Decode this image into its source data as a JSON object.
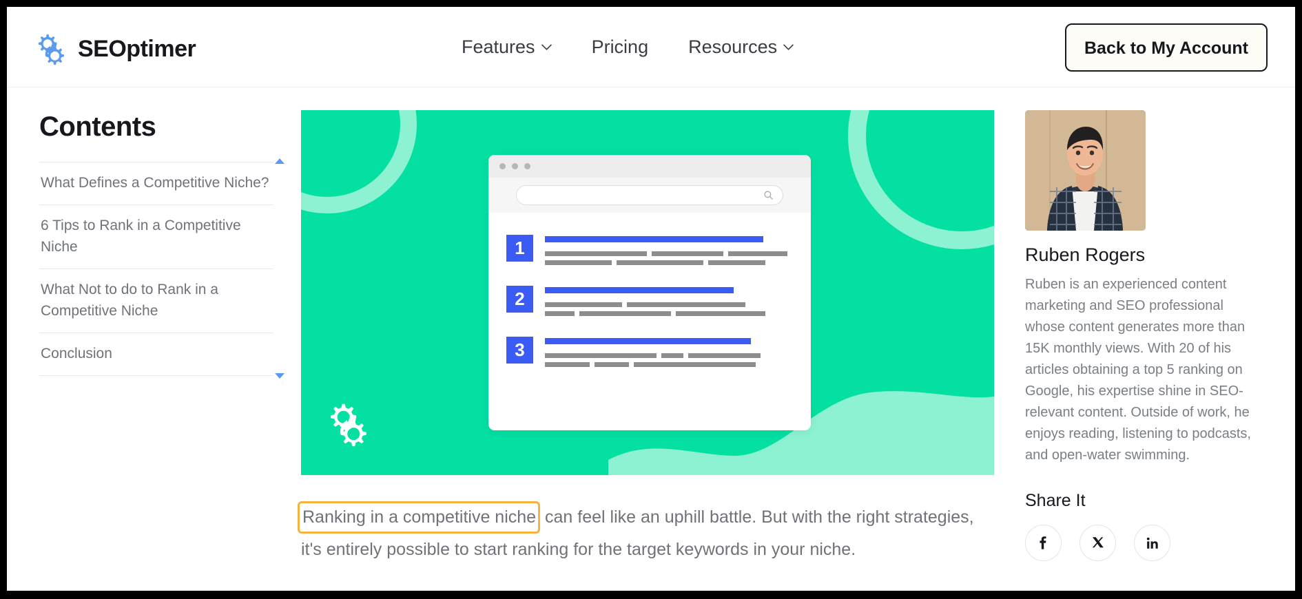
{
  "header": {
    "logo_text": "SEOptimer",
    "logo_icon": "seoptimer-gear-logo",
    "nav": [
      {
        "label": "Features",
        "has_dropdown": true,
        "icon": "chevron-down-icon"
      },
      {
        "label": "Pricing",
        "has_dropdown": false,
        "icon": ""
      },
      {
        "label": "Resources",
        "has_dropdown": true,
        "icon": "chevron-down-icon"
      }
    ],
    "account_button": "Back to My Account"
  },
  "sidebar": {
    "title": "Contents",
    "scroll_up_icon": "triangle-up-icon",
    "scroll_down_icon": "triangle-down-icon",
    "items": [
      {
        "label": "What Defines a Competitive Niche?"
      },
      {
        "label": "6 Tips to Rank in a Competitive Niche"
      },
      {
        "label": "What Not to do to Rank in a Competitive Niche"
      },
      {
        "label": "Conclusion"
      }
    ]
  },
  "hero": {
    "alt": "green illustration of a browser window with a ranked list",
    "background_color": "#03E0A1",
    "accent_color": "#8CF2D2",
    "watermark_icon": "seoptimer-gear-logo-white",
    "browser": {
      "search_icon": "search-icon",
      "dots": 3,
      "rows": [
        {
          "number": "1"
        },
        {
          "number": "2"
        },
        {
          "number": "3"
        }
      ],
      "bar_color": "#3B5BF5",
      "line_color": "#8d8d8d"
    }
  },
  "article": {
    "highlighted_text": "Ranking in a competitive niche",
    "highlight_color": "#F5B440",
    "paragraph_rest": " can feel like an uphill battle. But with the right strategies, it's entirely possible to start ranking for the target keywords in your niche."
  },
  "author": {
    "photo_alt": "Ruben Rogers portrait",
    "name": "Ruben Rogers",
    "bio": "Ruben is an experienced content marketing and SEO professional whose content generates more than 15K monthly views. With 20 of his articles obtaining a top 5 ranking on Google, his expertise shine in SEO-relevant content. Outside of work, he enjoys reading, listening to podcasts, and open-water swimming."
  },
  "share": {
    "title": "Share It",
    "buttons": [
      {
        "icon": "facebook-icon",
        "glyph": "f"
      },
      {
        "icon": "x-twitter-icon",
        "glyph": "X"
      },
      {
        "icon": "linkedin-icon",
        "glyph": "in"
      }
    ]
  }
}
